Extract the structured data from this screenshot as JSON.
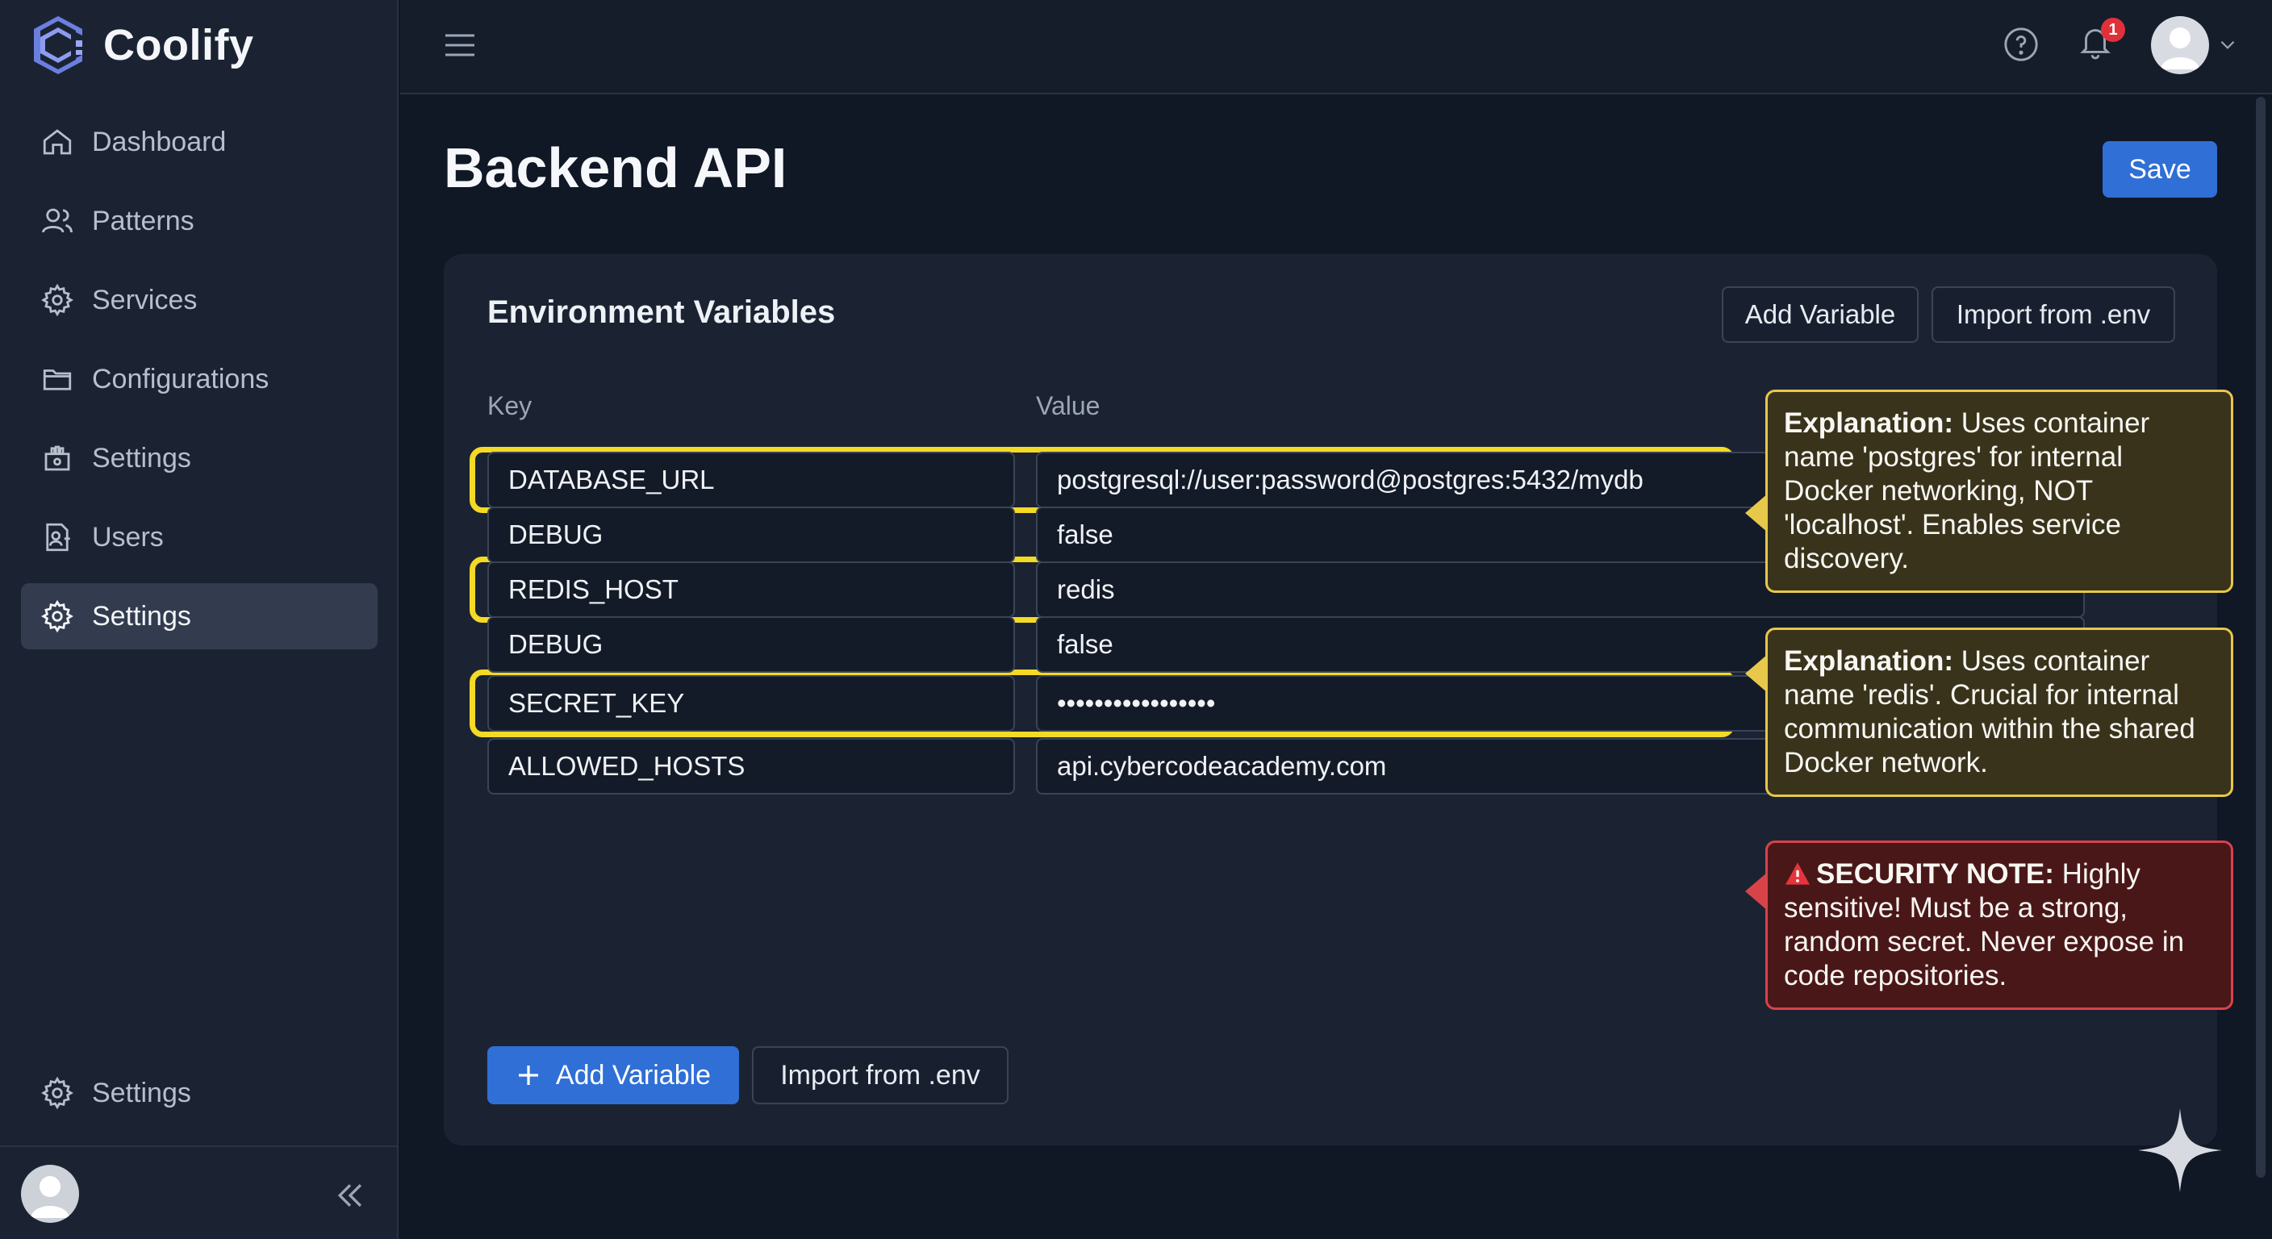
{
  "brand": {
    "name": "Coolify"
  },
  "sidebar": {
    "items": [
      {
        "label": "Dashboard",
        "icon": "home-icon"
      },
      {
        "label": "Patterns",
        "icon": "users-icon"
      },
      {
        "label": "Services",
        "icon": "gear-icon"
      },
      {
        "label": "Configurations",
        "icon": "folder-icon"
      },
      {
        "label": "Settings",
        "icon": "hand-gear-icon"
      },
      {
        "label": "Users",
        "icon": "user-file-icon"
      },
      {
        "label": "Settings",
        "icon": "gear-icon",
        "active": true
      }
    ],
    "bottom_item": {
      "label": "Settings",
      "icon": "gear-icon"
    }
  },
  "topbar": {
    "notification_count": "1"
  },
  "page": {
    "title": "Backend API",
    "save_label": "Save"
  },
  "env": {
    "title": "Environment Variables",
    "add_label": "Add Variable",
    "import_label": "Import from .env",
    "key_header": "Key",
    "value_header": "Value",
    "rows": [
      {
        "key": "DATABASE_URL",
        "value": "postgresql://user:password@postgres:5432/mydb",
        "highlighted": true
      },
      {
        "key": "DEBUG",
        "value": "false",
        "highlighted": false
      },
      {
        "key": "REDIS_HOST",
        "value": "redis",
        "highlighted": true
      },
      {
        "key": "DEBUG",
        "value": "false",
        "highlighted": false
      },
      {
        "key": "SECRET_KEY",
        "value": "•••••••••••••••••",
        "highlighted": true
      },
      {
        "key": "ALLOWED_HOSTS",
        "value": "api.cybercodeacademy.com",
        "highlighted": false
      }
    ],
    "bottom_add_label": "Add Variable",
    "bottom_import_label": "Import from .env"
  },
  "callouts": [
    {
      "heading": "Explanation:",
      "text": " Uses container name 'postgres' for internal Docker networking, NOT 'localhost'. Enables service discovery.",
      "kind": "explanation"
    },
    {
      "heading": "Explanation:",
      "text": " Uses container name 'redis'. Crucial for internal communication within the shared Docker network.",
      "kind": "explanation"
    },
    {
      "heading": "SECURITY NOTE:",
      "text": " Highly sensitive! Must be a strong, random secret. Never expose in code repositories.",
      "kind": "security"
    }
  ],
  "colors": {
    "accent": "#2f6fd6",
    "highlight": "#f4d925",
    "danger": "#d8434a",
    "background": "#101725"
  }
}
